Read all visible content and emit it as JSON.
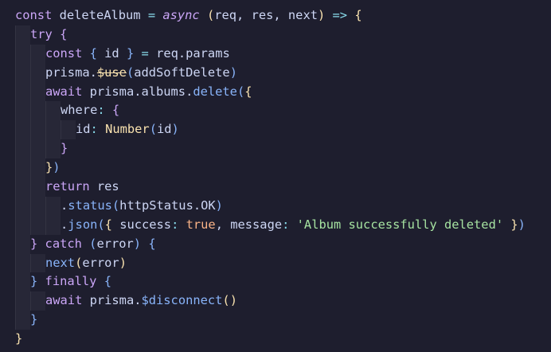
{
  "editor": {
    "lines": [
      {
        "depth": 0,
        "tokens": [
          [
            "kw",
            "const "
          ],
          [
            "plain",
            "deleteAlbum "
          ],
          [
            "op",
            "= "
          ],
          [
            "ital",
            "async "
          ],
          [
            "paren1",
            "("
          ],
          [
            "plain",
            "req, res, next"
          ],
          [
            "paren1",
            ") "
          ],
          [
            "op",
            "=> "
          ],
          [
            "paren1",
            "{"
          ]
        ]
      },
      {
        "depth": 1,
        "tokens": [
          [
            "kw",
            "try "
          ],
          [
            "paren2",
            "{"
          ]
        ]
      },
      {
        "depth": 2,
        "tokens": [
          [
            "kw",
            "const "
          ],
          [
            "paren3",
            "{ "
          ],
          [
            "plain",
            "id "
          ],
          [
            "paren3",
            "} "
          ],
          [
            "op",
            "= "
          ],
          [
            "plain",
            "req.params"
          ]
        ]
      },
      {
        "depth": 2,
        "tokens": [
          [
            "plain",
            "prisma."
          ],
          [
            "dep",
            "$use"
          ],
          [
            "paren3",
            "("
          ],
          [
            "plain",
            "addSoftDelete"
          ],
          [
            "paren3",
            ")"
          ]
        ]
      },
      {
        "depth": 2,
        "tokens": [
          [
            "kw",
            "await "
          ],
          [
            "plain",
            "prisma.albums."
          ],
          [
            "fn",
            "delete"
          ],
          [
            "paren3",
            "("
          ],
          [
            "paren1",
            "{"
          ]
        ]
      },
      {
        "depth": 3,
        "tokens": [
          [
            "key",
            "where"
          ],
          [
            "op",
            ": "
          ],
          [
            "paren2",
            "{"
          ]
        ]
      },
      {
        "depth": 4,
        "tokens": [
          [
            "key",
            "id"
          ],
          [
            "op",
            ": "
          ],
          [
            "prop",
            "Number"
          ],
          [
            "paren3",
            "("
          ],
          [
            "plain",
            "id"
          ],
          [
            "paren3",
            ")"
          ]
        ]
      },
      {
        "depth": 3,
        "tokens": [
          [
            "paren2",
            "}"
          ]
        ]
      },
      {
        "depth": 2,
        "tokens": [
          [
            "paren1",
            "}"
          ],
          [
            "paren3",
            ")"
          ]
        ]
      },
      {
        "depth": 2,
        "tokens": [
          [
            "kw",
            "return "
          ],
          [
            "plain",
            "res"
          ]
        ]
      },
      {
        "depth": 3,
        "tokens": [
          [
            "plain",
            "."
          ],
          [
            "fn",
            "status"
          ],
          [
            "paren3",
            "("
          ],
          [
            "plain",
            "httpStatus.OK"
          ],
          [
            "paren3",
            ")"
          ]
        ]
      },
      {
        "depth": 3,
        "tokens": [
          [
            "plain",
            "."
          ],
          [
            "fn",
            "json"
          ],
          [
            "paren3",
            "("
          ],
          [
            "paren1",
            "{ "
          ],
          [
            "key",
            "success"
          ],
          [
            "op",
            ": "
          ],
          [
            "bool",
            "true"
          ],
          [
            "plain",
            ", "
          ],
          [
            "key",
            "message"
          ],
          [
            "op",
            ": "
          ],
          [
            "str",
            "'Album successfully deleted' "
          ],
          [
            "paren1",
            "}"
          ],
          [
            "paren3",
            ")"
          ]
        ]
      },
      {
        "depth": 1,
        "tokens": [
          [
            "paren2",
            "} "
          ],
          [
            "kw",
            "catch "
          ],
          [
            "paren3",
            "("
          ],
          [
            "plain",
            "error"
          ],
          [
            "paren3",
            ") "
          ],
          [
            "paren3",
            "{"
          ]
        ]
      },
      {
        "depth": 2,
        "tokens": [
          [
            "fn",
            "next"
          ],
          [
            "paren1",
            "("
          ],
          [
            "plain",
            "error"
          ],
          [
            "paren1",
            ")"
          ]
        ]
      },
      {
        "depth": 1,
        "tokens": [
          [
            "paren3",
            "} "
          ],
          [
            "kw",
            "finally "
          ],
          [
            "paren3",
            "{"
          ]
        ]
      },
      {
        "depth": 2,
        "tokens": [
          [
            "kw",
            "await "
          ],
          [
            "plain",
            "prisma."
          ],
          [
            "fn",
            "$disconnect"
          ],
          [
            "paren1",
            "()"
          ]
        ]
      },
      {
        "depth": 1,
        "tokens": [
          [
            "paren3",
            "}"
          ]
        ]
      },
      {
        "depth": 0,
        "tokens": [
          [
            "paren1",
            "}"
          ]
        ]
      }
    ]
  }
}
